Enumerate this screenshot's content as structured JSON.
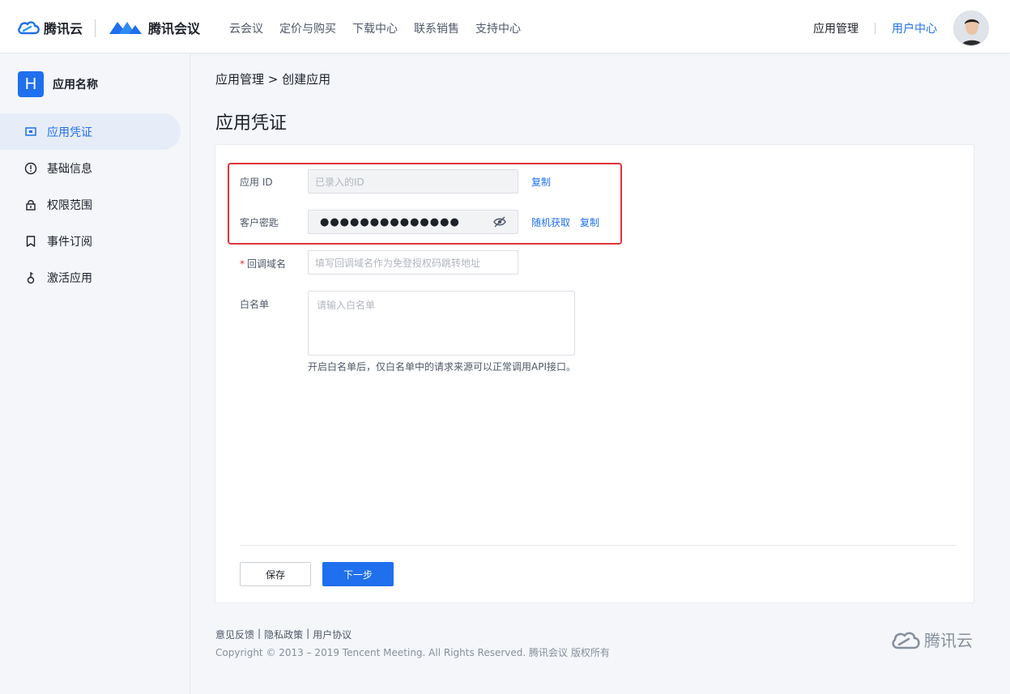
{
  "header": {
    "logo_tencent_cloud": "腾讯云",
    "logo_meeting": "腾讯会议",
    "nav": [
      "云会议",
      "定价与购买",
      "下载中心",
      "联系销售",
      "支持中心"
    ],
    "app_management": "应用管理",
    "user_center": "用户中心"
  },
  "sidebar": {
    "app_badge": "H",
    "app_name": "应用名称",
    "items": [
      {
        "label": "应用凭证",
        "icon": "credential-icon",
        "active": true
      },
      {
        "label": "基础信息",
        "icon": "info-icon"
      },
      {
        "label": "权限范围",
        "icon": "lock-icon"
      },
      {
        "label": "事件订阅",
        "icon": "bookmark-icon"
      },
      {
        "label": "激活应用",
        "icon": "key-icon"
      }
    ]
  },
  "breadcrumb": "应用管理 > 创建应用",
  "page_title": "应用凭证",
  "form": {
    "app_id_label": "应用 ID",
    "app_id_placeholder": "已录入的ID",
    "copy_label": "复制",
    "secret_label": "客户密匙",
    "secret_value": "●●●●●●●●●●●●●●",
    "random_label": "随机获取",
    "callback_required": "*",
    "callback_label": "回调域名",
    "callback_placeholder": "填写回调域名作为免登授权码跳转地址",
    "whitelist_label": "白名单",
    "whitelist_placeholder": "请输入白名单",
    "whitelist_hint": "开启白名单后，仅白名单中的请求来源可以正常调用API接口。",
    "save_button": "保存",
    "next_button": "下一步"
  },
  "footer": {
    "links": [
      "意见反馈",
      "隐私政策",
      "用户协议"
    ],
    "link_separator": "|",
    "copyright": "Copyright © 2013 – 2019 Tencent Meeting. All Rights Reserved.  腾讯会议 版权所有",
    "logo": "腾讯云"
  },
  "colors": {
    "accent": "#1f6fee",
    "highlight": "#e0333a"
  }
}
